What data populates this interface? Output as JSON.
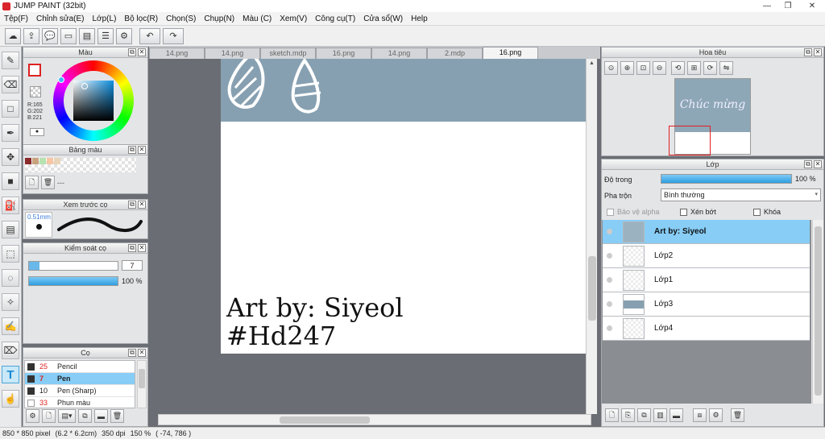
{
  "window": {
    "title": "JUMP PAINT (32bit)",
    "minimize": "—",
    "maximize": "❐",
    "close": "✕"
  },
  "menu": [
    "Tệp(F)",
    "Chỉnh sửa(E)",
    "Lớp(L)",
    "Bộ lọc(R)",
    "Chọn(S)",
    "Chụp(N)",
    "Màu (C)",
    "Xem(V)",
    "Công cụ(T)",
    "Cửa sổ(W)",
    "Help"
  ],
  "toolbar": {
    "icons": [
      "cloud-icon",
      "export-icon",
      "comment-icon",
      "message-icon",
      "doc-icon",
      "doc-list-icon",
      "settings-icon"
    ],
    "undo": "↶",
    "redo": "↷"
  },
  "tools": [
    {
      "name": "brush-tool",
      "glyph": "✎"
    },
    {
      "name": "eraser-tool",
      "glyph": "⌫"
    },
    {
      "name": "rectangle-tool",
      "glyph": "□"
    },
    {
      "name": "pen-tool",
      "glyph": "✒"
    },
    {
      "name": "move-tool",
      "glyph": "✥"
    },
    {
      "name": "fill-rect-tool",
      "glyph": "■"
    },
    {
      "name": "bucket-tool",
      "glyph": "⛽"
    },
    {
      "name": "gradient-tool",
      "glyph": "▤"
    },
    {
      "name": "select-rect-tool",
      "glyph": "⬚"
    },
    {
      "name": "lasso-tool",
      "glyph": "◌"
    },
    {
      "name": "magic-wand-tool",
      "glyph": "✧"
    },
    {
      "name": "select-pen-tool",
      "glyph": "✍"
    },
    {
      "name": "select-eraser-tool",
      "glyph": "⌦"
    },
    {
      "name": "text-tool",
      "glyph": "T"
    },
    {
      "name": "hand-tool",
      "glyph": "☝"
    }
  ],
  "color_panel": {
    "title": "Màu",
    "r": "R:165",
    "g": "G:202",
    "b": "B:221",
    "fg_color": "#a5cadd",
    "bg_color": "#555555"
  },
  "palette_panel": {
    "title": "Bảng màu",
    "swatches": [
      "#8b2a2a",
      "#c9a27e",
      "#b6e3b0",
      "#f7c6a4",
      "#e8d4b8"
    ],
    "dash": "---"
  },
  "preview_panel": {
    "title": "Xem trước cọ",
    "size": "0.51mm"
  },
  "control_panel": {
    "title": "Kiểm soát cọ",
    "size_value": "7",
    "opacity_value": "100 %",
    "opacity_fraction": 1.0
  },
  "brush_panel": {
    "title": "Cọ",
    "brushes": [
      {
        "size": "25",
        "name": "Pencil",
        "selected": false,
        "red": true
      },
      {
        "size": "7",
        "name": "Pen",
        "selected": true,
        "red": true
      },
      {
        "size": "10",
        "name": "Pen (Sharp)",
        "selected": false,
        "red": false
      },
      {
        "size": "33",
        "name": "Phun màu",
        "selected": false,
        "red": true
      }
    ]
  },
  "tabs": [
    "14.png",
    "14.png",
    "sketch.mdp",
    "16.png",
    "14.png",
    "2.mdp",
    "16.png"
  ],
  "active_tab": 6,
  "canvas": {
    "line1": "Art by: Siyeol",
    "line2": "#Hd247"
  },
  "navigator": {
    "title": "Hoa tiêu",
    "thumb_text": "Chúc mừng",
    "icons": [
      "zoom-reset-icon",
      "zoom-in-icon",
      "fit-icon",
      "zoom-out-icon",
      "rotate-left-icon",
      "fit-window-icon",
      "rotate-right-icon",
      "flip-icon"
    ]
  },
  "layer_panel": {
    "title": "Lớp",
    "opacity_label": "Độ trong",
    "opacity_value": "100 %",
    "opacity_fraction": 1.0,
    "blend_label": "Pha trộn",
    "blend_value": "Bình thường",
    "protect_alpha": "Bảo vệ alpha",
    "clip": "Xén bớt",
    "lock": "Khóa",
    "layers": [
      {
        "name": "Art by: Siyeol",
        "selected": true,
        "bold": true
      },
      {
        "name": "Lớp2",
        "selected": false,
        "bold": false
      },
      {
        "name": "Lớp1",
        "selected": false,
        "bold": false
      },
      {
        "name": "Lớp3",
        "selected": false,
        "bold": false
      },
      {
        "name": "Lớp4",
        "selected": false,
        "bold": false
      }
    ]
  },
  "status": {
    "size": "850 * 850 pixel",
    "cm": "(6.2 * 6.2cm)",
    "dpi": "350 dpi",
    "zoom": "150 %",
    "coords": "( -74, 786 )"
  },
  "colors": {
    "accent": "#87cdf6",
    "canvas_band": "#87a0b1"
  }
}
